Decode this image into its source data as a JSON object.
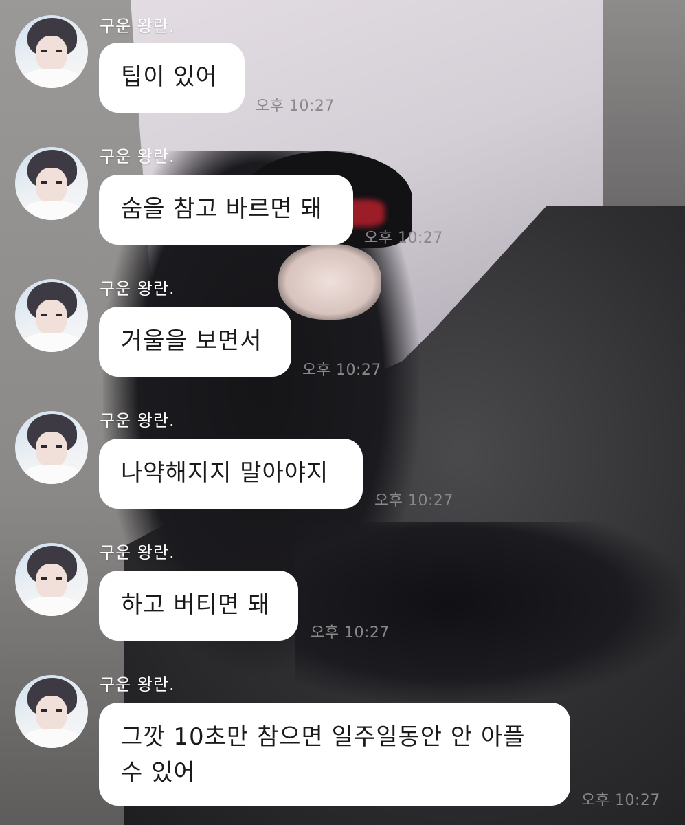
{
  "messages": [
    {
      "sender": "구운 왕란.",
      "text": "팁이 있어",
      "time": "오후 10:27"
    },
    {
      "sender": "구운 왕란.",
      "text": "숨을 참고 바르면 돼",
      "time": "오후 10:27"
    },
    {
      "sender": "구운 왕란.",
      "text": "거울을 보면서",
      "time": "오후 10:27"
    },
    {
      "sender": "구운 왕란.",
      "text": "나약해지지 말아야지",
      "time": "오후 10:27"
    },
    {
      "sender": "구운 왕란.",
      "text": "하고 버티면 돼",
      "time": "오후 10:27"
    },
    {
      "sender": "구운 왕란.",
      "text": "그깟 10초만 참으면 일주일동안 안 아플 수 있어",
      "time": "오후 10:27"
    }
  ]
}
